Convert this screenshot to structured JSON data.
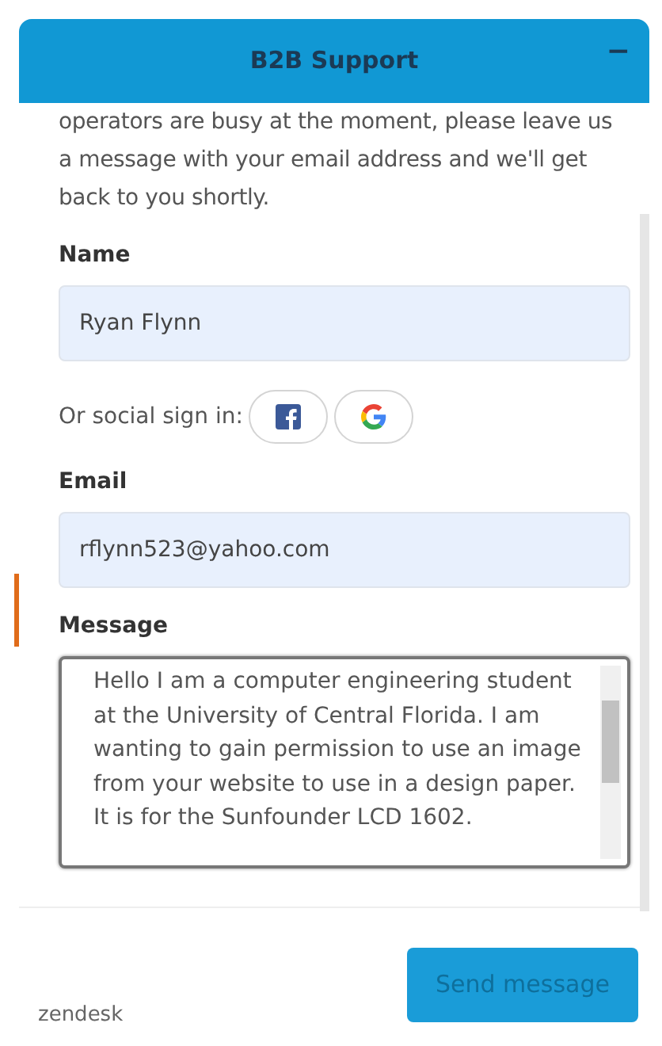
{
  "header": {
    "title": "B2B Support",
    "minimize": "−"
  },
  "intro": "operators are busy at the moment, please leave us a message with your email address and we'll get back to you shortly.",
  "fields": [
    {
      "kind": "input",
      "label": "Name",
      "value": "Ryan Flynn"
    },
    {
      "kind": "social",
      "label": "Or social sign in:"
    },
    {
      "kind": "input",
      "label": "Email",
      "value": "rflynn523@yahoo.com"
    },
    {
      "kind": "textarea",
      "label": "Message",
      "value": "Hello I am a computer engineering student at the University of Central Florida. I am wanting to gain permission to use an image from your website to use in a design paper. It is for the Sunfounder LCD 1602."
    }
  ],
  "footer": {
    "brand": "zendesk",
    "button": "Send message"
  }
}
